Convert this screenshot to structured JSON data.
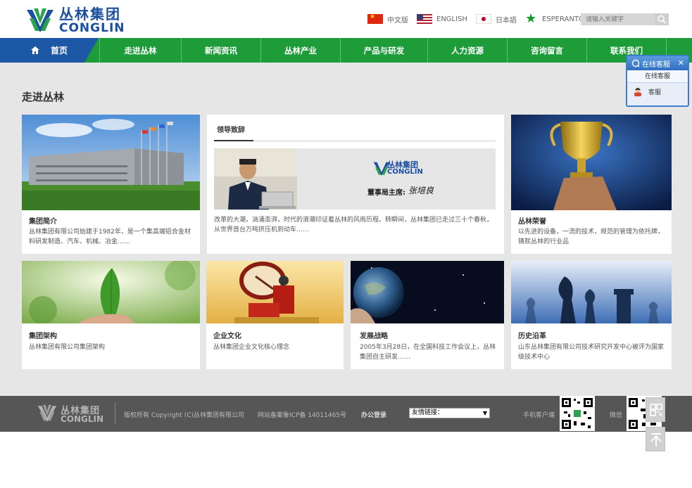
{
  "header": {
    "logo_cn": "丛林集团",
    "logo_en": "CONGLIN",
    "languages": [
      {
        "label": "中文版",
        "icon": "flag-cn-icon"
      },
      {
        "label": "ENGLISH",
        "icon": "flag-us-icon"
      },
      {
        "label": "日本語",
        "icon": "flag-jp-icon"
      },
      {
        "label": "ESPERANTO",
        "icon": "star-green-icon"
      }
    ],
    "search_placeholder": "请输入关键字"
  },
  "nav": {
    "home": "首页",
    "items": [
      "走进丛林",
      "新闻资讯",
      "丛林产业",
      "产品与研发",
      "人力资源",
      "咨询留言",
      "联系我们"
    ]
  },
  "main": {
    "title": "走进丛林",
    "cards": {
      "intro": {
        "title": "集团简介",
        "desc": "丛林集团有限公司始建于1982年，是一个集高端铝合金材料研发制造、汽车、机械、冶金……"
      },
      "speech": {
        "tab": "领导致辞",
        "banner_cn": "丛林集团",
        "banner_en": "CONGLIN",
        "chairman_label": "董事局主席:",
        "signature": "张培良",
        "desc": "改革的大潮，汹涌澎湃，时代的浪潮印证着丛林的风雨历程。转瞬间，丛林集团已走过三十个春秋，从世界首台万吨挤压机到动车……"
      },
      "honor": {
        "title": "丛林荣誉",
        "desc": "以先进的设备，一流的技术，规范的管理为依托牌，铸就丛林的行业品"
      },
      "structure": {
        "title": "集团架构",
        "desc": "丛林集团有限公司集团架构"
      },
      "culture": {
        "title": "企业文化",
        "desc": "丛林集团企业文化核心理念"
      },
      "strategy": {
        "title": "发展战略",
        "desc": "2005年3月28日，在全国科技工作会议上，丛林集团自主研发……"
      },
      "history": {
        "title": "历史沿革",
        "desc": "山东丛林集团有限公司技术研究开发中心被评为国家级技术中心"
      }
    }
  },
  "service": {
    "title": "在线客服",
    "subtitle": "在线客服",
    "agent": "客服"
  },
  "footer": {
    "logo_cn": "丛林集团",
    "logo_en": "CONGLIN",
    "copyright": "版权所有 Copyright (C)丛林集团有限公司",
    "icp": "网站备案鲁ICP备 14011465号",
    "office_login": "办公登录",
    "links_select": "友情链接：",
    "mobile": "手机客户端",
    "wechat": "微信"
  },
  "colors": {
    "nav_green": "#1f9c3a",
    "home_blue": "#1d58a6",
    "brand_blue": "#1a4fa0",
    "footer_gray": "#565656"
  }
}
